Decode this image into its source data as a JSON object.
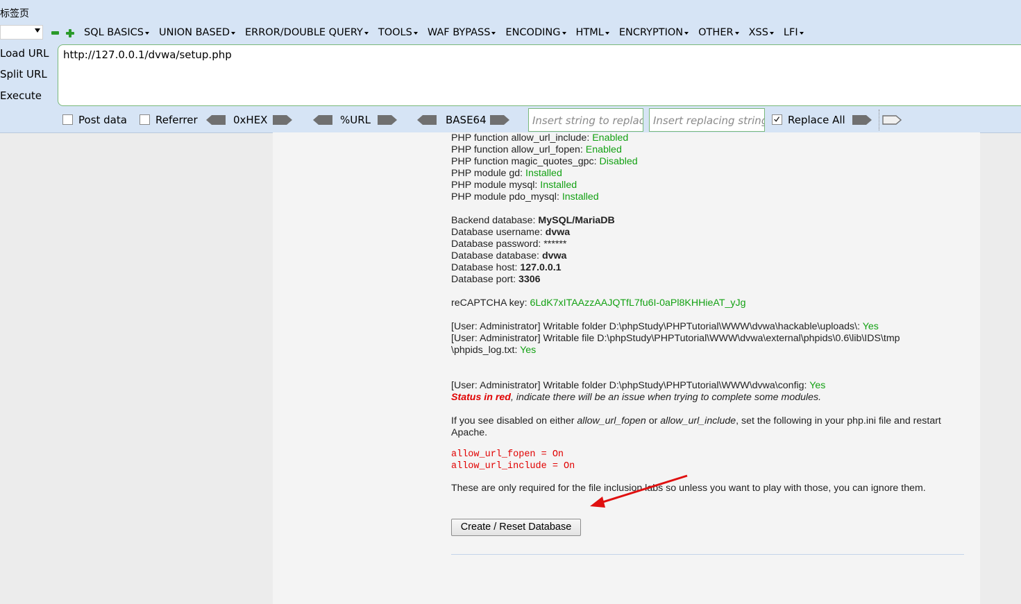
{
  "browser": {
    "tab_title": "标签页",
    "menu": [
      "SQL BASICS",
      "UNION BASED",
      "ERROR/DOUBLE QUERY",
      "TOOLS",
      "WAF BYPASS",
      "ENCODING",
      "HTML",
      "ENCRYPTION",
      "OTHER",
      "XSS",
      "LFI"
    ],
    "load_url": "Load URL",
    "split_url": "Split URL",
    "execute": "Execute",
    "url": "http://127.0.0.1/dvwa/setup.php",
    "post_data": "Post data",
    "referrer": "Referrer",
    "hex": "0xHEX",
    "url_enc": "%URL",
    "base64": "BASE64",
    "find_placeholder": "Insert string to replace",
    "replace_placeholder": "Insert replacing string",
    "replace_all": "Replace All",
    "replace_all_checked": true
  },
  "checks": [
    {
      "label": "PHP function allow_url_include: ",
      "value": "Enabled"
    },
    {
      "label": "PHP function allow_url_fopen: ",
      "value": "Enabled"
    },
    {
      "label": "PHP function magic_quotes_gpc: ",
      "value": "Disabled"
    },
    {
      "label": "PHP module gd: ",
      "value": "Installed"
    },
    {
      "label": "PHP module mysql: ",
      "value": "Installed"
    },
    {
      "label": "PHP module pdo_mysql: ",
      "value": "Installed"
    }
  ],
  "db": [
    {
      "label": "Backend database: ",
      "value": "MySQL/MariaDB"
    },
    {
      "label": "Database username: ",
      "value": "dvwa"
    },
    {
      "label": "Database password: ",
      "value": "******"
    },
    {
      "label": "Database database: ",
      "value": "dvwa"
    },
    {
      "label": "Database host: ",
      "value": "127.0.0.1"
    },
    {
      "label": "Database port: ",
      "value": "3306"
    }
  ],
  "recaptcha": {
    "label": "reCAPTCHA key: ",
    "value": "6LdK7xITAAzzAAJQTfL7fu6I-0aPl8KHHieAT_yJg"
  },
  "writable": [
    {
      "text": "[User: Administrator] Writable folder D:\\phpStudy\\PHPTutorial\\WWW\\dvwa\\hackable\\uploads\\: ",
      "value": "Yes"
    },
    {
      "text": "[User: Administrator] Writable file D:\\phpStudy\\PHPTutorial\\WWW\\dvwa\\external\\phpids\\0.6\\lib\\IDS\\tmp",
      "value": ""
    },
    {
      "text": "\\phpids_log.txt: ",
      "value": "Yes"
    }
  ],
  "config_folder": {
    "text": "[User: Administrator] Writable folder D:\\phpStudy\\PHPTutorial\\WWW\\dvwa\\config: ",
    "value": "Yes"
  },
  "status_red": "Status in red",
  "status_note": ", indicate there will be an issue when trying to complete some modules.",
  "disabled_note": {
    "p1": "If you see disabled on either ",
    "fopen": "allow_url_fopen",
    "or": " or ",
    "include": "allow_url_include",
    "p2": ", set the following in your php.ini file and restart",
    "p3": "Apache."
  },
  "code_lines": [
    "allow_url_fopen = On",
    "allow_url_include = On"
  ],
  "only_required": "These are only required for the file inclusion labs so unless you want to play with those, you can ignore them.",
  "create_button": "Create / Reset Database",
  "colors": {
    "ok": "#13a113",
    "error": "#e00000",
    "arrow": "#e01010"
  }
}
